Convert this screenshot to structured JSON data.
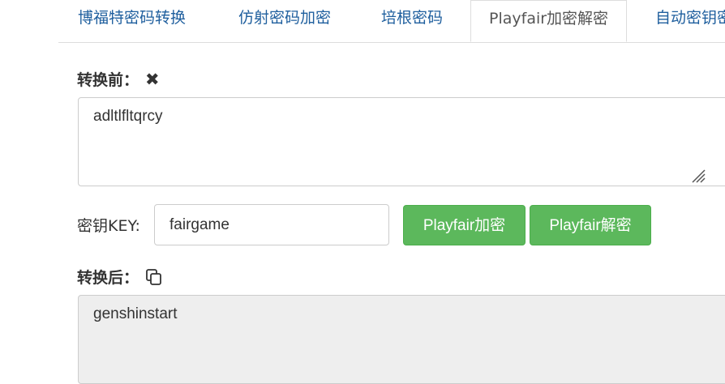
{
  "tabs": [
    {
      "label": "博福特密码转换"
    },
    {
      "label": "仿射密码加密"
    },
    {
      "label": "培根密码"
    },
    {
      "label": "Playfair加密解密"
    },
    {
      "label": "自动密钥密"
    }
  ],
  "input": {
    "label": "转换前：",
    "clear_icon": "close-icon",
    "value": "adltlfltqrcy"
  },
  "key": {
    "label": "密钥KEY:",
    "value": "fairgame"
  },
  "buttons": {
    "encrypt": "Playfair加密",
    "decrypt": "Playfair解密"
  },
  "output": {
    "label": "转换后：",
    "copy_icon": "copy-icon",
    "value": "genshinstart"
  },
  "colors": {
    "button": "#5cb85c",
    "tab_link": "#1f5f9e",
    "readonly_bg": "#eeeeee"
  }
}
